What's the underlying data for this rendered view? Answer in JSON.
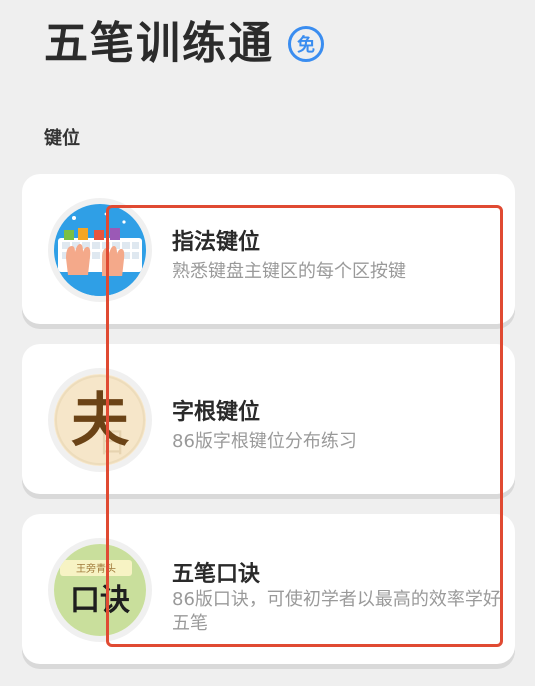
{
  "header": {
    "title": "五笔训练通",
    "badge": "免"
  },
  "section": {
    "title": "键位"
  },
  "cards": [
    {
      "title": "指法键位",
      "subtitle": "熟悉键盘主键区的每个区按键",
      "icon": "keyboard-hands-icon"
    },
    {
      "title": "字根键位",
      "subtitle": "86版字根键位分布练习",
      "icon": "radical-character-icon",
      "icon_text": "夫"
    },
    {
      "title": "五笔口诀",
      "subtitle": "86版口诀，可使初学者以最高的效率学好五笔",
      "icon": "mnemonic-scroll-icon",
      "icon_text": "口诀",
      "icon_caption": "王旁青头"
    }
  ],
  "colors": {
    "background": "#efefef",
    "card": "#ffffff",
    "accent_blue": "#3a8df0",
    "highlight_red": "#e04a32"
  }
}
